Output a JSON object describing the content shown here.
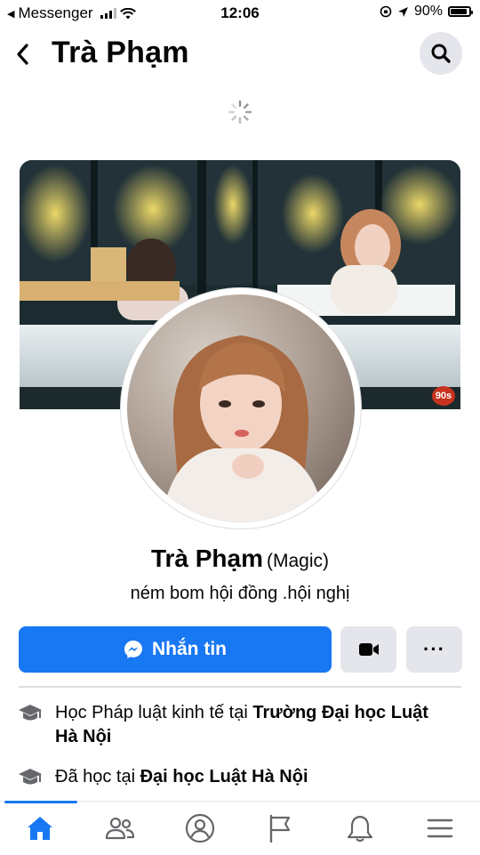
{
  "status_bar": {
    "back_app": "Messenger",
    "time": "12:06",
    "battery": "90%",
    "battery_level": 0.9
  },
  "header": {
    "title": "Trà Phạm"
  },
  "profile": {
    "name": "Trà Phạm",
    "alternate_name": "(Magic)",
    "bio": "ném bom hội đồng .hội nghị",
    "cover_badge": "90s"
  },
  "actions": {
    "message_label": "Nhắn tin",
    "more_label": "···"
  },
  "details": [
    {
      "prefix": "Học Pháp luật kinh tế tại ",
      "strong": "Trường Đại học Luật Hà Nội",
      "icon": "graduation-cap-icon"
    },
    {
      "prefix": "Đã học tại ",
      "strong": "Đại học Luật Hà Nội",
      "icon": "graduation-cap-icon"
    }
  ],
  "nav": {
    "items": [
      "home-icon",
      "friends-icon",
      "profile-icon",
      "pages-flag-icon",
      "notifications-bell-icon",
      "menu-icon"
    ],
    "active": "home-icon"
  },
  "colors": {
    "accent": "#1877f2",
    "button_gray": "#e4e6eb",
    "text": "#050505"
  }
}
